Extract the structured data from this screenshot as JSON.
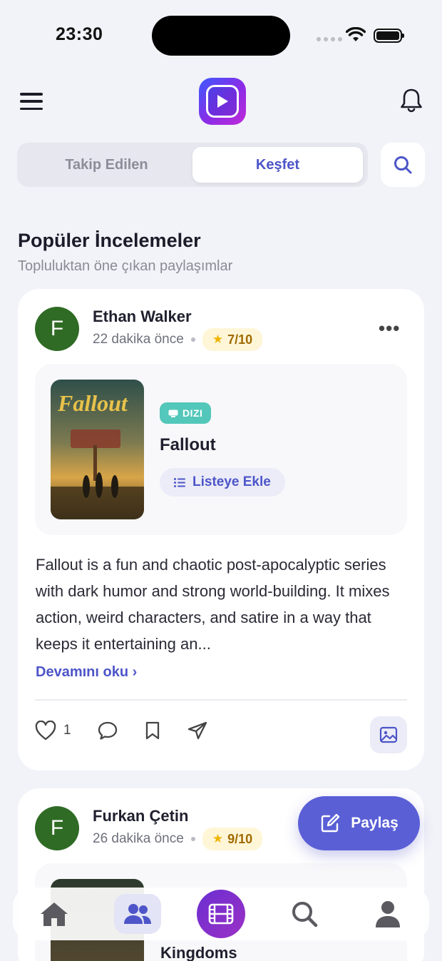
{
  "status_bar": {
    "time": "23:30"
  },
  "header": {
    "menu_icon": "hamburger-icon",
    "logo_icon": "play-icon",
    "bell_icon": "bell-icon"
  },
  "tabs": [
    {
      "label": "Takip Edilen",
      "active": false
    },
    {
      "label": "Keşfet",
      "active": true
    }
  ],
  "section": {
    "title": "Popüler İncelemeler",
    "subtitle": "Topluluktan öne çıkan paylaşımlar"
  },
  "posts": [
    {
      "avatar_letter": "F",
      "user": "Ethan Walker",
      "time": "22 dakika önce",
      "rating": "7/10",
      "media": {
        "type_badge": "DIZI",
        "title": "Fallout",
        "poster_title": "Fallout",
        "list_button": "Listeye Ekle"
      },
      "text": "Fallout is a fun and chaotic post-apocalyptic series with dark humor and strong world-building. It mixes action, weird characters, and satire in a way that keeps it entertaining an...",
      "read_more": "Devamını oku",
      "likes": "1"
    },
    {
      "avatar_letter": "F",
      "user": "Furkan Çetin",
      "time": "26 dakika önce",
      "rating": "9/10",
      "media": {
        "title": "Kingdoms"
      }
    }
  ],
  "fab": {
    "label": "Paylaş"
  },
  "colors": {
    "accent": "#4d55c8",
    "fab": "#5a5fd6",
    "avatar": "#2f6b24",
    "badge": "#53c7ba"
  }
}
